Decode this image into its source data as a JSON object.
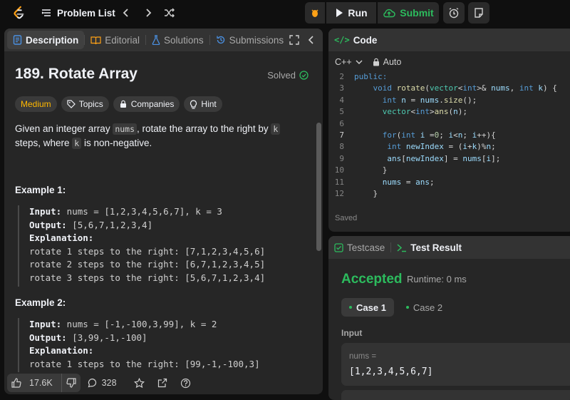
{
  "topbar": {
    "problem_list": "Problem List",
    "run": "Run",
    "submit": "Submit"
  },
  "left_panel": {
    "tabs": [
      {
        "label": "Description",
        "icon": "description-icon"
      },
      {
        "label": "Editorial",
        "icon": "book-icon"
      },
      {
        "label": "Solutions",
        "icon": "flask-icon"
      },
      {
        "label": "Submissions",
        "icon": "history-icon"
      }
    ],
    "title": "189. Rotate Array",
    "solved": "Solved",
    "tags": {
      "difficulty": "Medium",
      "topics": "Topics",
      "companies": "Companies",
      "hint": "Hint"
    },
    "description": {
      "p1": "Given an integer array ",
      "code1": "nums",
      "p2": ", rotate the array to the right by ",
      "code2": "k",
      "p3": " steps, where ",
      "code3": "k",
      "p4": " is non-negative."
    },
    "example1": {
      "heading": "Example 1:",
      "input_label": "Input:",
      "input": " nums = [1,2,3,4,5,6,7], k = 3",
      "output_label": "Output:",
      "output": " [5,6,7,1,2,3,4]",
      "explanation_label": "Explanation:",
      "lines": [
        "rotate 1 steps to the right: [7,1,2,3,4,5,6]",
        "rotate 2 steps to the right: [6,7,1,2,3,4,5]",
        "rotate 3 steps to the right: [5,6,7,1,2,3,4]"
      ]
    },
    "example2": {
      "heading": "Example 2:",
      "input_label": "Input:",
      "input": " nums = [-1,-100,3,99], k = 2",
      "output_label": "Output:",
      "output": " [3,99,-1,-100]",
      "explanation_label": "Explanation:",
      "lines": [
        "rotate 1 steps to the right: [99,-1,-100,3]"
      ]
    },
    "footer": {
      "likes": "17.6K",
      "comments": "328"
    }
  },
  "code_panel": {
    "title": "Code",
    "language": "C++",
    "mode": "Auto",
    "saved": "Saved",
    "lines": [
      {
        "n": "2",
        "t": "public:"
      },
      {
        "n": "3",
        "t": "    void rotate(vector<int>& nums, int k) {"
      },
      {
        "n": "4",
        "t": "      int n = nums.size();"
      },
      {
        "n": "5",
        "t": "      vector<int>ans(n);"
      },
      {
        "n": "6",
        "t": ""
      },
      {
        "n": "7",
        "t": "      for(int i =0; i<n; i++){"
      },
      {
        "n": "8",
        "t": "       int newIndex = (i+k)%n;"
      },
      {
        "n": "9",
        "t": "       ans[newIndex] = nums[i];"
      },
      {
        "n": "10",
        "t": "      }"
      },
      {
        "n": "11",
        "t": "      nums = ans;"
      },
      {
        "n": "12",
        "t": "    }"
      }
    ]
  },
  "test_panel": {
    "tab_testcase": "Testcase",
    "tab_result": "Test Result",
    "status": "Accepted",
    "runtime": "Runtime: 0 ms",
    "cases": [
      "Case 1",
      "Case 2"
    ],
    "input_label": "Input",
    "input_name": "nums =",
    "input_value": "[1,2,3,4,5,6,7]"
  },
  "colors": {
    "accepted": "#2cbb5d",
    "medium": "#ffb800",
    "tab_code": "#2cbb5d"
  }
}
